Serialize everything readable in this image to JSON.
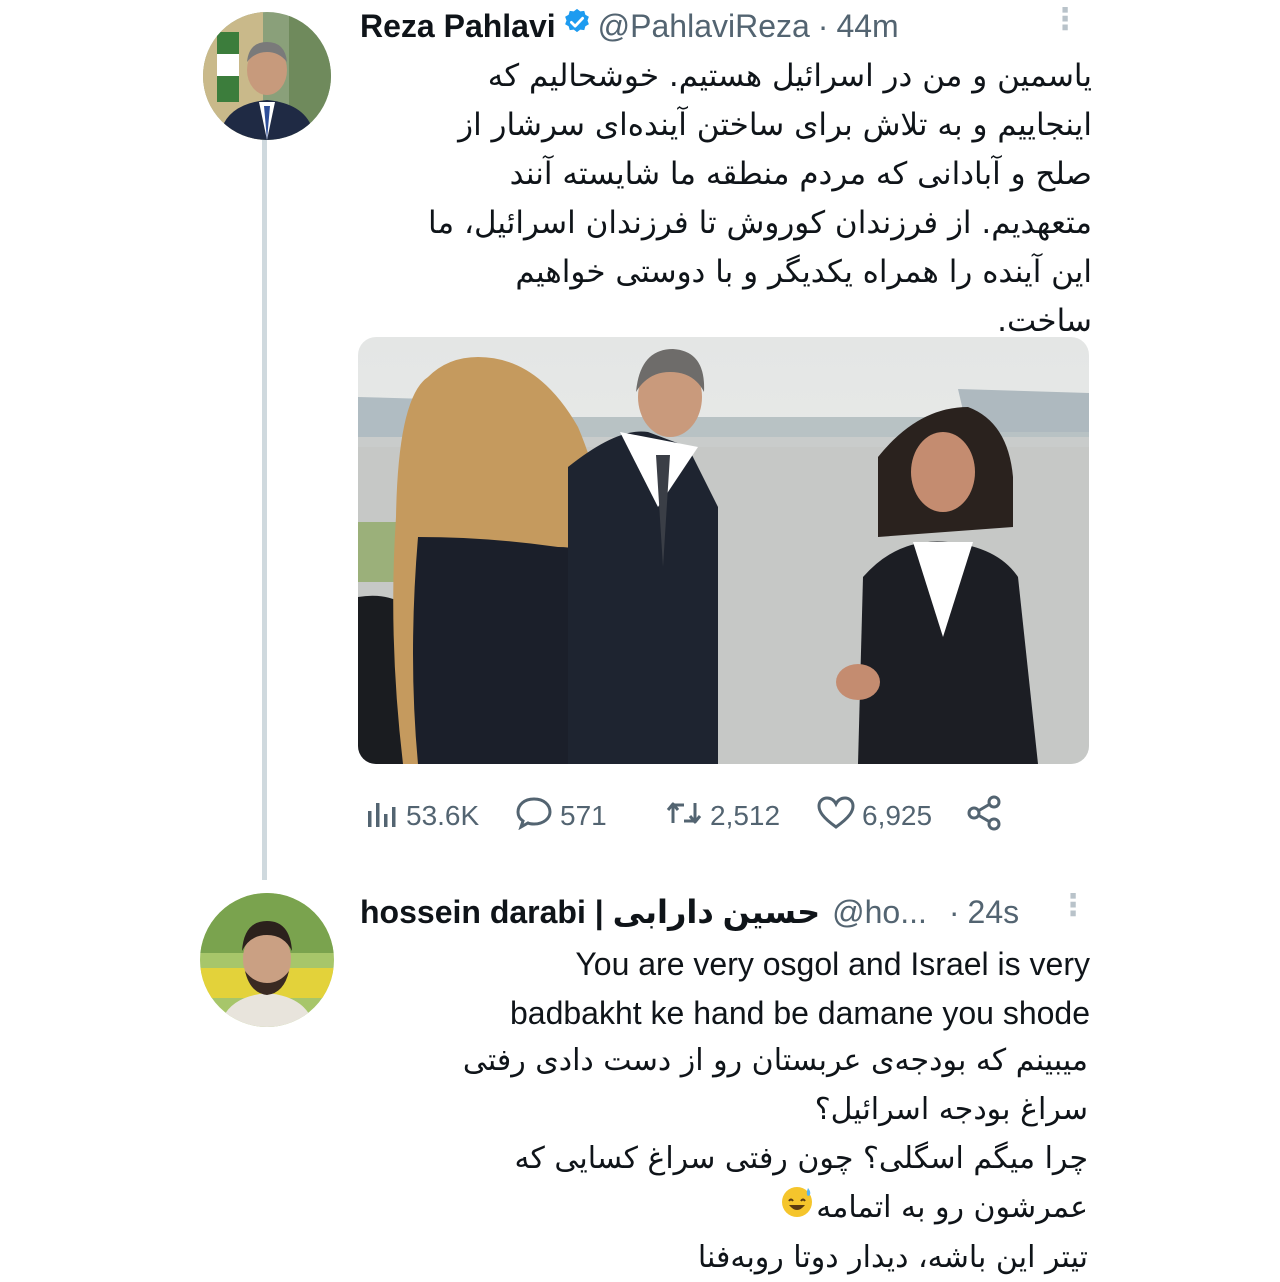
{
  "tweet1": {
    "name": "Reza Pahlavi",
    "handle": "@PahlaviReza",
    "separator": "·",
    "time": "44m",
    "text_lines": [
      "یاسمین و من در اسرائیل هستیم. خوشحالیم که",
      "اینجاییم و به تلاش برای ساختن آینده‌ای سرشار از",
      "صلح و آبادانی که مردم منطقه ما شایسته آنند",
      "متعهدیم. از فرزندان کوروش تا فرزندان اسرائیل، ما",
      "این آینده را همراه یکدیگر و با دوستی خواهیم",
      "ساخت."
    ],
    "stats": {
      "views": "53.6K",
      "replies": "571",
      "retweets": "2,512",
      "likes": "6,925"
    }
  },
  "tweet2": {
    "name": "hossein darabi | حسین دارابی",
    "handle": "@ho...",
    "separator": "·",
    "time": "24s",
    "text_en_lines": [
      "You are very osgol and Israel is very",
      "badbakht ke hand be damane you shode"
    ],
    "text_fa_lines": [
      "میبینم که بودجه‌ی عربستان رو از دست دادی رفتی",
      "سراغ بودجه اسرائیل؟",
      "چرا میگم اسگلی؟ چون رفتی سراغ کسایی که",
      "عمرشون رو به اتمامه",
      "تیتر این باشه، دیدار دوتا روبه‌فنا"
    ]
  },
  "icons": {
    "verified": "verified-badge-icon",
    "more": "more-vertical-icon",
    "views": "analytics-icon",
    "reply": "reply-icon",
    "retweet": "retweet-icon",
    "like": "heart-icon",
    "share": "share-icon",
    "emoji": "sweat-smile-emoji"
  },
  "colors": {
    "verified_blue": "#1d9bf0",
    "secondary_text": "#536471",
    "thread_line": "#cfd9de"
  }
}
